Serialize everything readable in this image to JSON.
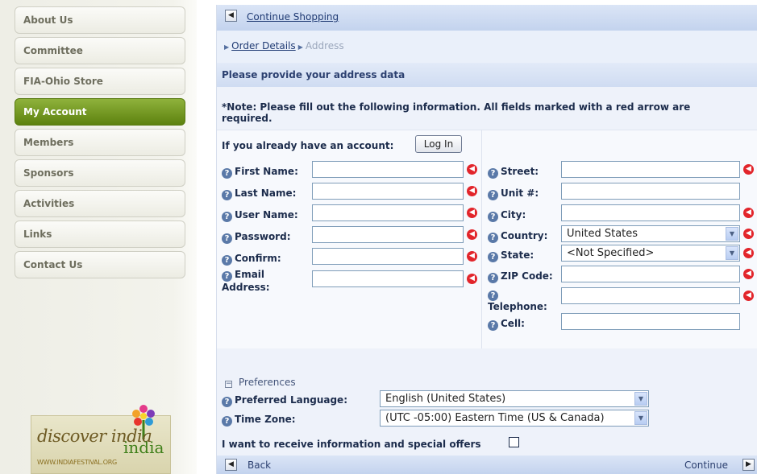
{
  "sidebar": {
    "items": [
      {
        "label": "About Us"
      },
      {
        "label": "Committee"
      },
      {
        "label": "FIA-Ohio Store"
      },
      {
        "label": "My Account",
        "active": true
      },
      {
        "label": "Members"
      },
      {
        "label": "Sponsors"
      },
      {
        "label": "Activities"
      },
      {
        "label": "Links"
      },
      {
        "label": "Contact Us"
      }
    ],
    "logo": {
      "script": "discover india",
      "india": "india",
      "url": "WWW.INDIAFESTIVAL.ORG"
    }
  },
  "nav": {
    "continue_shopping": "Continue Shopping",
    "back": "Back",
    "continue": "Continue"
  },
  "breadcrumb": {
    "order_details": "Order Details",
    "address": "Address"
  },
  "page": {
    "title": "Please provide your address data",
    "note": "*Note: Please fill out the following information. All fields marked with a red arrow are required.",
    "have_account": "If you already have an account:",
    "login_button": "Log In"
  },
  "form": {
    "left": [
      {
        "label": "First Name:",
        "value": "",
        "required": true
      },
      {
        "label": "Last Name:",
        "value": "",
        "required": true
      },
      {
        "label": "User Name:",
        "value": "",
        "required": true
      },
      {
        "label": "Password:",
        "value": "",
        "required": true
      },
      {
        "label": "Confirm:",
        "value": "",
        "required": true
      },
      {
        "label": "Email",
        "label2": "Address:",
        "value": "",
        "required": true
      }
    ],
    "right": {
      "street": {
        "label": "Street:",
        "value": "",
        "required": true
      },
      "unit": {
        "label": "Unit #:",
        "value": "",
        "required": false
      },
      "city": {
        "label": "City:",
        "value": "",
        "required": true
      },
      "country": {
        "label": "Country:",
        "selected": "United States",
        "required": true
      },
      "state": {
        "label": "State:",
        "selected": "<Not Specified>",
        "required": true
      },
      "zip": {
        "label": "ZIP Code:",
        "value": "",
        "required": true
      },
      "telephone": {
        "label": "Telephone:",
        "value": "",
        "required": true
      },
      "cell": {
        "label": "Cell:",
        "value": "",
        "required": false
      }
    }
  },
  "preferences": {
    "toggle_label": "Preferences",
    "language": {
      "label": "Preferred Language:",
      "selected": "English (United States)"
    },
    "timezone": {
      "label": "Time Zone:",
      "selected": "(UTC -05:00) Eastern Time (US & Canada)"
    },
    "optin_label": "I want to receive information and special offers",
    "optin_checked": false
  },
  "colors": {
    "active_nav": "#6f9320",
    "required_marker": "#e2252b",
    "link": "#1f3a73"
  },
  "icons": {
    "help": "question-circle-icon",
    "required": "required-arrow-icon",
    "back": "arrow-left-icon",
    "forward": "arrow-right-icon"
  }
}
